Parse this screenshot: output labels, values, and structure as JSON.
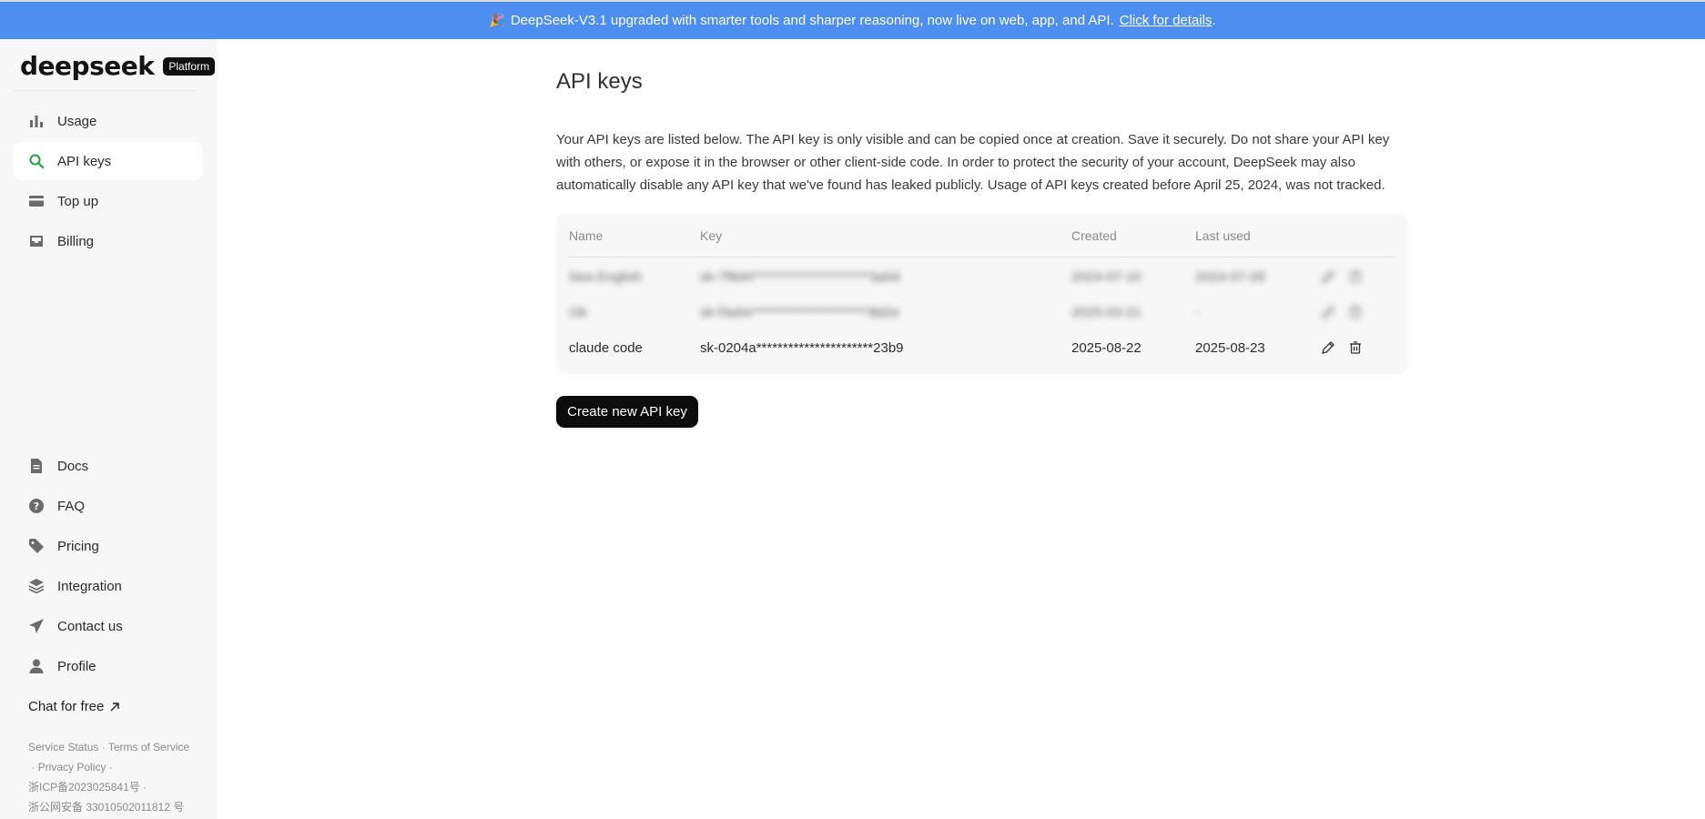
{
  "banner": {
    "icon": "party-popper-icon",
    "text": "DeepSeek-V3.1 upgraded with smarter tools and sharper reasoning, now live on web, app, and API.",
    "link": "Click for details",
    "suffix": ".",
    "color": "#4d8ff0"
  },
  "brand": {
    "name": "deepseek",
    "badge": "Platform"
  },
  "sidebar": {
    "top_items": [
      {
        "label": "Usage",
        "icon": "bar-chart-icon"
      },
      {
        "label": "API keys",
        "icon": "search-key-icon",
        "active": true
      },
      {
        "label": "Top up",
        "icon": "card-icon"
      },
      {
        "label": "Billing",
        "icon": "inbox-icon"
      }
    ],
    "bottom_items": [
      {
        "label": "Docs",
        "icon": "document-icon"
      },
      {
        "label": "FAQ",
        "icon": "question-icon"
      },
      {
        "label": "Pricing",
        "icon": "tag-icon"
      },
      {
        "label": "Integration",
        "icon": "layers-icon"
      },
      {
        "label": "Contact us",
        "icon": "send-icon"
      },
      {
        "label": "Profile",
        "icon": "user-icon"
      }
    ],
    "chat_link": "Chat for free",
    "footer": {
      "service_status": "Service Status",
      "terms": "Terms of Service",
      "privacy": "Privacy Policy",
      "icp": "浙ICP备2023025841号",
      "police": "浙公网安备 33010502011812 号"
    }
  },
  "main": {
    "title": "API keys",
    "description": "Your API keys are listed below. The API key is only visible and can be copied once at creation. Save it securely. Do not share your API key with others, or expose it in the browser or other client-side code. In order to protect the security of your account, DeepSeek may also automatically disable any API key that we've found has leaked publicly. Usage of API keys created before April 25, 2024, was not tracked.",
    "table": {
      "headers": {
        "name": "Name",
        "key": "Key",
        "created": "Created",
        "last_used": "Last used"
      },
      "rows": [
        {
          "name": "Sea English",
          "key": "sk-7f8d4**********************3a0d",
          "created": "2024-07-10",
          "last_used": "2024-07-28",
          "blurred": true
        },
        {
          "name": "Ob",
          "key": "sk-f3a5e**********************8d2e",
          "created": "2025-03-21",
          "last_used": "-",
          "blurred": true
        },
        {
          "name": "claude code",
          "key": "sk-0204a**********************23b9",
          "created": "2025-08-22",
          "last_used": "2025-08-23",
          "blurred": false
        }
      ]
    },
    "create_button": "Create new API key"
  }
}
